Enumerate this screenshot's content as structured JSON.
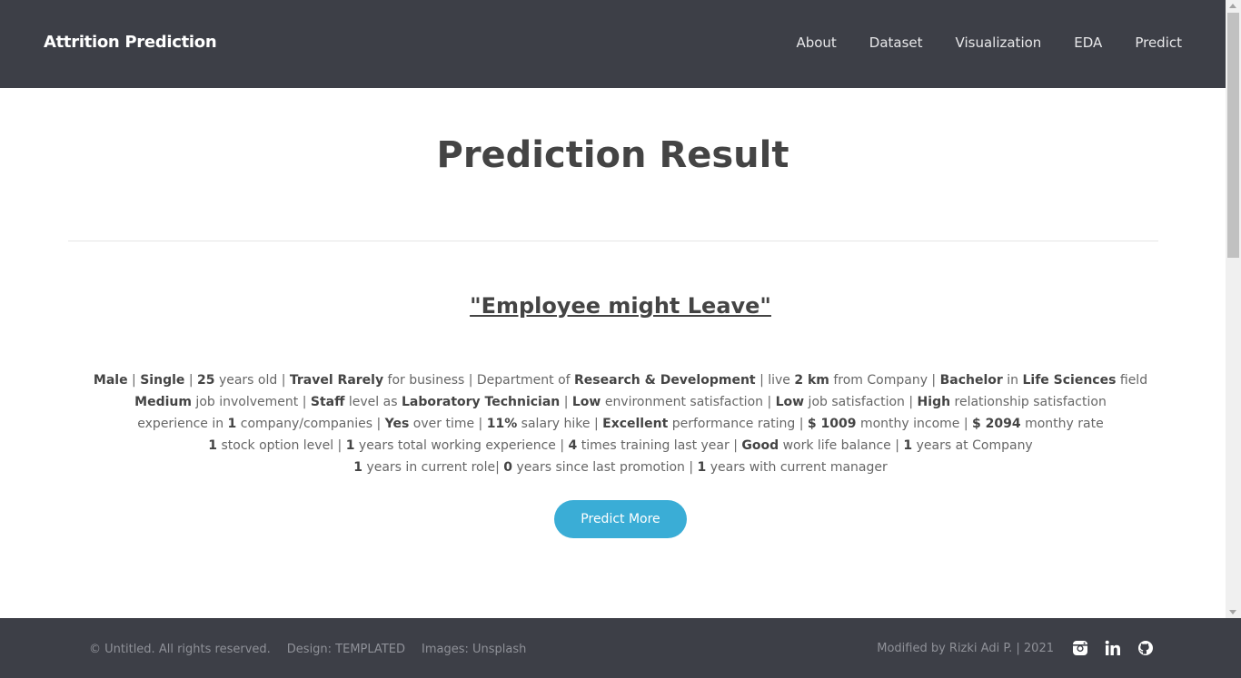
{
  "header": {
    "brand": "Attrition Prediction",
    "nav": [
      "About",
      "Dataset",
      "Visualization",
      "EDA",
      "Predict"
    ]
  },
  "main": {
    "title": "Prediction Result",
    "verdict": "\"Employee might Leave\"",
    "details": {
      "gender": "Male",
      "marital_status": "Single",
      "age": "25",
      "business_travel": "Travel Rarely",
      "department": "Research & Development",
      "distance": "2 km",
      "education": "Bachelor",
      "education_field": "Life Sciences",
      "job_involvement": "Medium",
      "job_level": "Staff",
      "job_role": "Laboratory Technician",
      "environment_satisfaction": "Low",
      "job_satisfaction": "Low",
      "relationship_satisfaction": "High",
      "num_companies": "1",
      "overtime": "Yes",
      "salary_hike": "11%",
      "performance_rating": "Excellent",
      "monthly_income": "$ 1009",
      "monthly_rate": "$ 2094",
      "stock_option": "1",
      "total_working_years": "1",
      "training_times": "4",
      "work_life_balance": "Good",
      "years_at_company": "1",
      "years_in_role": "1",
      "years_since_promotion": "0",
      "years_with_manager": "1"
    },
    "button_label": "Predict More"
  },
  "footer": {
    "copyright": "© Untitled. All rights reserved.",
    "design": "Design: TEMPLATED",
    "images": "Images: Unsplash",
    "credit": "Modified by Rizki Adi P. | 2021",
    "icons": [
      "instagram-icon",
      "linkedin-icon",
      "github-icon"
    ]
  }
}
